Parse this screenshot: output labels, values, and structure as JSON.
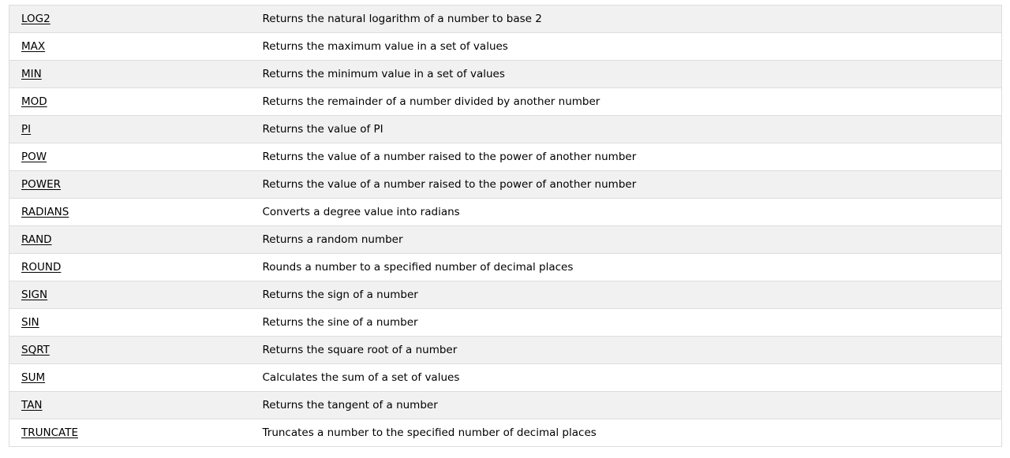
{
  "functions": {
    "rows": [
      {
        "name": "LOG2",
        "description": "Returns the natural logarithm of a number to base 2"
      },
      {
        "name": "MAX",
        "description": "Returns the maximum value in a set of values"
      },
      {
        "name": "MIN",
        "description": "Returns the minimum value in a set of values"
      },
      {
        "name": "MOD",
        "description": "Returns the remainder of a number divided by another number"
      },
      {
        "name": "PI",
        "description": "Returns the value of PI"
      },
      {
        "name": "POW",
        "description": "Returns the value of a number raised to the power of another number"
      },
      {
        "name": "POWER",
        "description": "Returns the value of a number raised to the power of another number"
      },
      {
        "name": "RADIANS",
        "description": "Converts a degree value into radians"
      },
      {
        "name": "RAND",
        "description": "Returns a random number"
      },
      {
        "name": "ROUND",
        "description": "Rounds a number to a specified number of decimal places"
      },
      {
        "name": "SIGN",
        "description": "Returns the sign of a number"
      },
      {
        "name": "SIN",
        "description": "Returns the sine of a number"
      },
      {
        "name": "SQRT",
        "description": "Returns the square root of a number"
      },
      {
        "name": "SUM",
        "description": "Calculates the sum of a set of values"
      },
      {
        "name": "TAN",
        "description": "Returns the tangent of a number"
      },
      {
        "name": "TRUNCATE",
        "description": "Truncates a number to the specified number of decimal places"
      }
    ]
  },
  "colors": {
    "row_alt": "#f1f1f1",
    "row_plain": "#ffffff",
    "border": "#dddddd",
    "text": "#000000"
  }
}
